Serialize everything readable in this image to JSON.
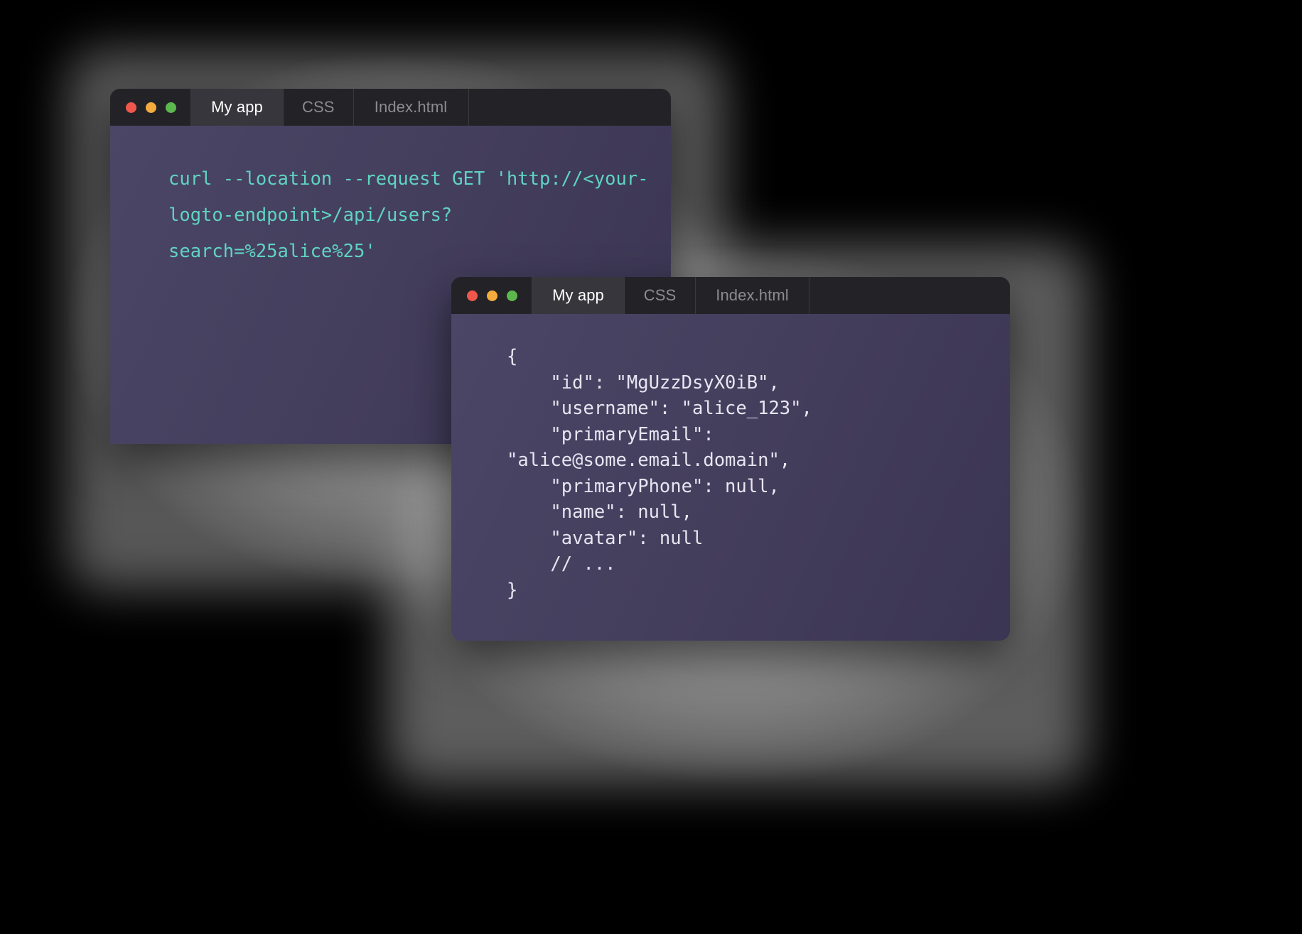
{
  "background_color": "#000000",
  "windows": [
    {
      "id": "curl-request-window",
      "chrome": {
        "traffic_lights": [
          {
            "name": "close",
            "color": "#f0574c"
          },
          {
            "name": "minimize",
            "color": "#f4ab3e"
          },
          {
            "name": "maximize",
            "color": "#5cb84d"
          }
        ],
        "tabs": [
          {
            "label": "My app",
            "active": true
          },
          {
            "label": "CSS",
            "active": false
          },
          {
            "label": "Index.html",
            "active": false
          }
        ]
      },
      "code": {
        "language": "shell",
        "text_color": "#5fd4c1",
        "lines": [
          "curl --location --request GET 'http://<your-",
          "logto-endpoint>/api/users?",
          "search=%25alice%25'"
        ]
      }
    },
    {
      "id": "json-response-window",
      "chrome": {
        "traffic_lights": [
          {
            "name": "close",
            "color": "#f0574c"
          },
          {
            "name": "minimize",
            "color": "#f4ab3e"
          },
          {
            "name": "maximize",
            "color": "#5cb84d"
          }
        ],
        "tabs": [
          {
            "label": "My app",
            "active": true
          },
          {
            "label": "CSS",
            "active": false
          },
          {
            "label": "Index.html",
            "active": false
          }
        ]
      },
      "code": {
        "language": "json",
        "text_color": "#e7e5f1",
        "lines": [
          "{",
          "    \"id\": \"MgUzzDsyX0iB\",",
          "    \"username\": \"alice_123\",",
          "    \"primaryEmail\":",
          "\"alice@some.email.domain\",",
          "    \"primaryPhone\": null,",
          "    \"name\": null,",
          "    \"avatar\": null",
          "    // ...",
          "}"
        ]
      }
    }
  ]
}
